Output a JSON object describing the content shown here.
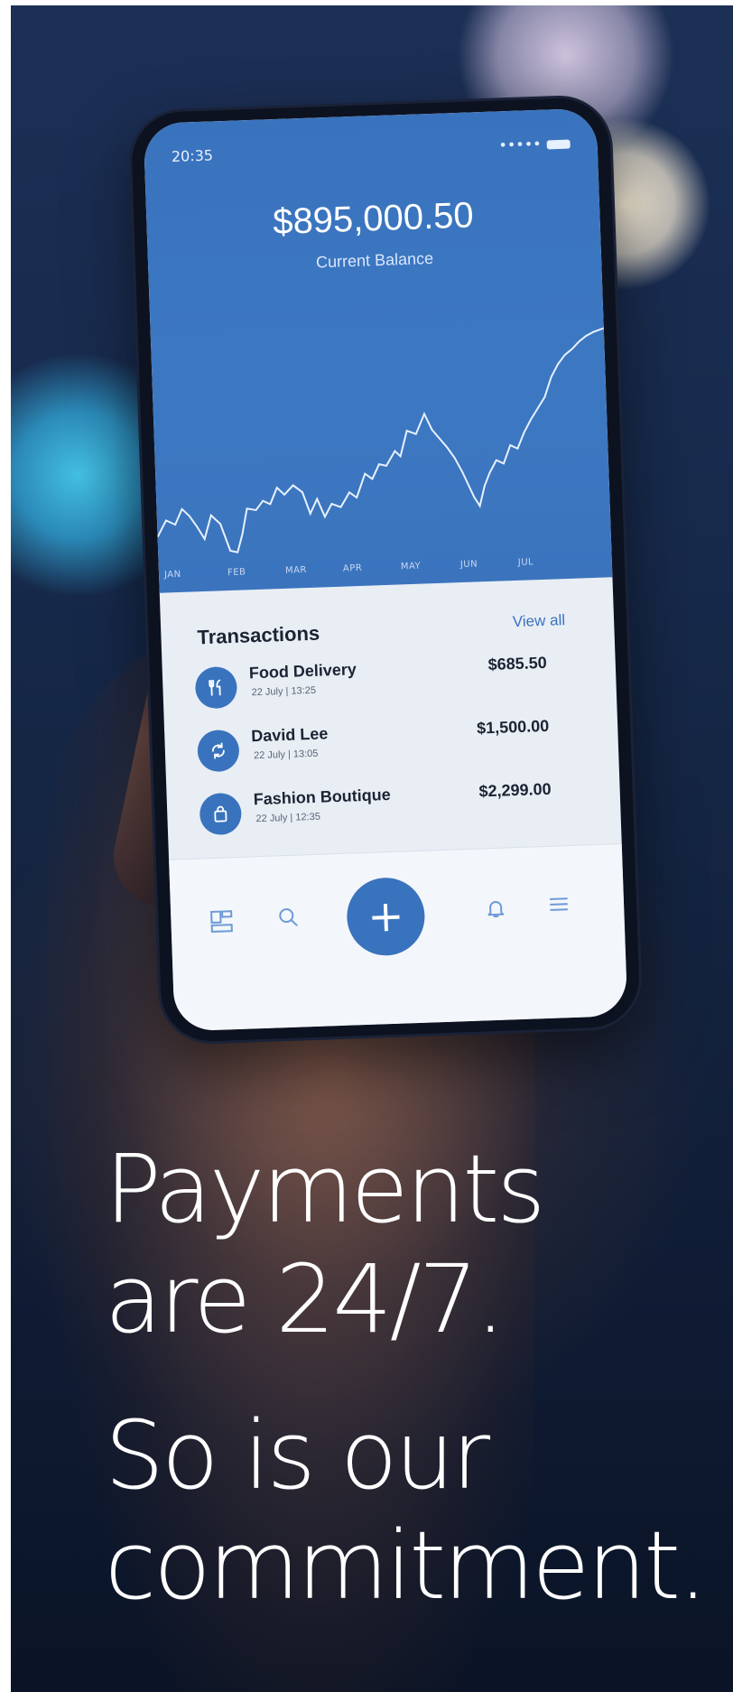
{
  "headline": {
    "line1": "Payments",
    "line2": "are 24/7.",
    "line3": "So is our",
    "line4": "commitment."
  },
  "phone": {
    "status_time": "20:35",
    "balance": "$895,000.50",
    "balance_label": "Current Balance",
    "chart_months": [
      "JAN",
      "FEB",
      "MAR",
      "APR",
      "MAY",
      "JUN",
      "JUL"
    ],
    "transactions_title": "Transactions",
    "view_all": "View all",
    "transactions": [
      {
        "name": "Food Delivery",
        "date": "22 July | 13:25",
        "amount": "$685.50",
        "icon": "cutlery-icon"
      },
      {
        "name": "David Lee",
        "date": "22 July | 13:05",
        "amount": "$1,500.00",
        "icon": "refresh-icon"
      },
      {
        "name": "Fashion Boutique",
        "date": "22 July | 12:35",
        "amount": "$2,299.00",
        "icon": "shopping-bag-icon"
      }
    ],
    "tabbar_icons": [
      "dashboard-icon",
      "search-icon",
      "add-icon",
      "bell-icon",
      "menu-icon"
    ]
  },
  "colors": {
    "accent": "#3a73bd",
    "background_dark": "#13233f",
    "text_light": "#ffffff"
  }
}
